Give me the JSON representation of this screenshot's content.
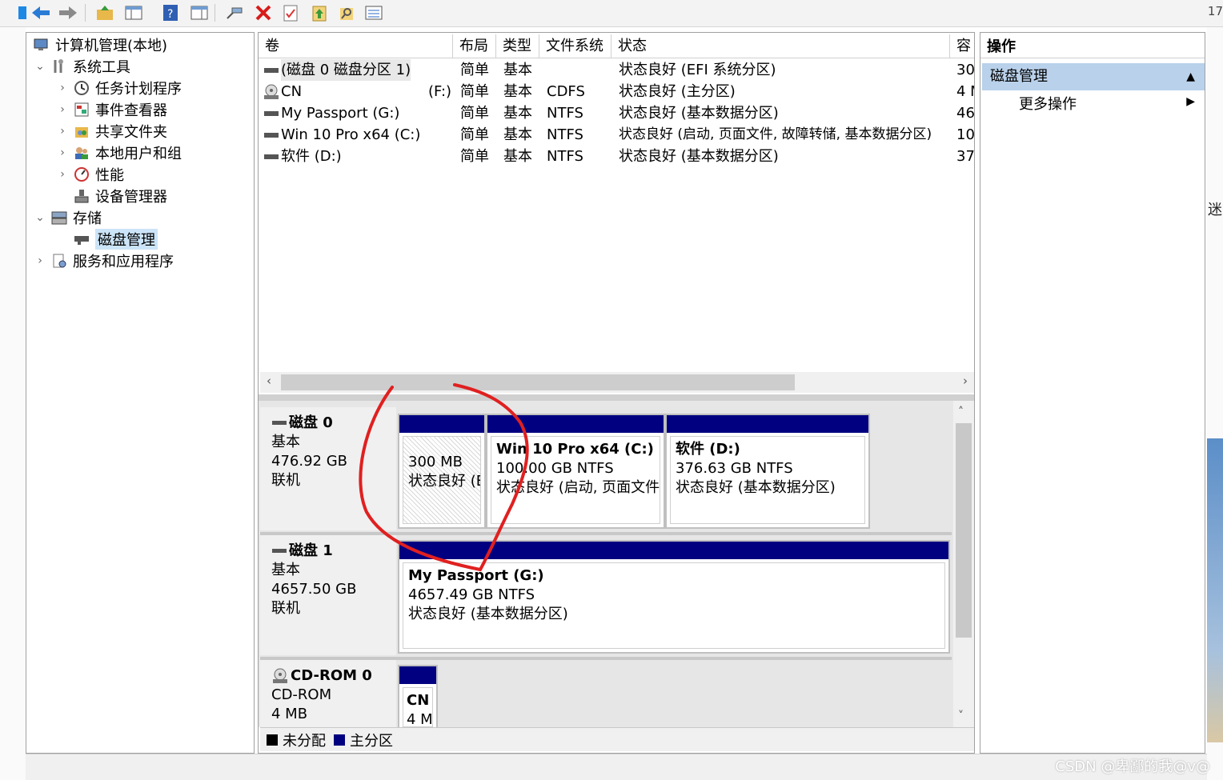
{
  "toolbar": {
    "right_text": "17"
  },
  "tree": [
    {
      "label": "计算机管理(本地)",
      "icon": "computer-management-icon",
      "level": 0,
      "chev": ""
    },
    {
      "label": "系统工具",
      "icon": "system-tools-icon",
      "level": 1,
      "chev": "⌄"
    },
    {
      "label": "任务计划程序",
      "icon": "task-scheduler-icon",
      "level": 2,
      "chev": "›"
    },
    {
      "label": "事件查看器",
      "icon": "event-viewer-icon",
      "level": 2,
      "chev": "›"
    },
    {
      "label": "共享文件夹",
      "icon": "shared-folders-icon",
      "level": 2,
      "chev": "›"
    },
    {
      "label": "本地用户和组",
      "icon": "local-users-icon",
      "level": 2,
      "chev": "›"
    },
    {
      "label": "性能",
      "icon": "performance-icon",
      "level": 2,
      "chev": "›"
    },
    {
      "label": "设备管理器",
      "icon": "device-manager-icon",
      "level": 2,
      "chev": ""
    },
    {
      "label": "存储",
      "icon": "storage-icon",
      "level": 1,
      "chev": "⌄"
    },
    {
      "label": "磁盘管理",
      "icon": "disk-management-icon",
      "level": 2,
      "chev": "",
      "selected": true
    },
    {
      "label": "服务和应用程序",
      "icon": "services-apps-icon",
      "level": 1,
      "chev": "›"
    }
  ],
  "volume_list": {
    "headers": [
      "卷",
      "布局",
      "类型",
      "文件系统",
      "状态",
      "容"
    ],
    "rows": [
      {
        "vol": "(磁盘 0 磁盘分区 1)",
        "drive": "",
        "layout": "简单",
        "type": "基本",
        "fs": "",
        "status": "状态良好 (EFI 系统分区)",
        "cap": "30",
        "icon": "drive-icon",
        "selected": true
      },
      {
        "vol": "CN",
        "drive": "(F:)",
        "layout": "简单",
        "type": "基本",
        "fs": "CDFS",
        "status": "状态良好 (主分区)",
        "cap": "4 M",
        "icon": "cdrom-icon"
      },
      {
        "vol": "My Passport (G:)",
        "drive": "",
        "layout": "简单",
        "type": "基本",
        "fs": "NTFS",
        "status": "状态良好 (基本数据分区)",
        "cap": "46",
        "icon": "drive-icon"
      },
      {
        "vol": "Win 10 Pro x64 (C:)",
        "drive": "",
        "layout": "简单",
        "type": "基本",
        "fs": "NTFS",
        "status": "状态良好 (启动, 页面文件, 故障转储, 基本数据分区)",
        "cap": "10",
        "icon": "drive-icon"
      },
      {
        "vol": "软件 (D:)",
        "drive": "",
        "layout": "简单",
        "type": "基本",
        "fs": "NTFS",
        "status": "状态良好 (基本数据分区)",
        "cap": "37",
        "icon": "drive-icon"
      }
    ]
  },
  "disks": [
    {
      "name": "磁盘 0",
      "type": "基本",
      "size": "476.92 GB",
      "state": "联机",
      "partitions": [
        {
          "title": "",
          "line1": "300 MB",
          "line2": "状态良好 (E"
        },
        {
          "title": "Win 10 Pro x64  (C:)",
          "line1": "100.00 GB NTFS",
          "line2": "状态良好 (启动, 页面文件"
        },
        {
          "title": "软件  (D:)",
          "line1": "376.63 GB NTFS",
          "line2": "状态良好 (基本数据分区)"
        }
      ]
    },
    {
      "name": "磁盘 1",
      "type": "基本",
      "size": "4657.50 GB",
      "state": "联机",
      "partitions": [
        {
          "title": "My Passport  (G:)",
          "line1": "4657.49 GB NTFS",
          "line2": "状态良好 (基本数据分区)"
        }
      ]
    },
    {
      "name": "CD-ROM 0",
      "type": "CD-ROM",
      "size": "4 MB",
      "state": "",
      "partitions": [
        {
          "title": "CN",
          "line1": "4 M",
          "line2": ""
        }
      ]
    }
  ],
  "legend": [
    {
      "label": "未分配",
      "color": "#000000"
    },
    {
      "label": "主分区",
      "color": "#000080"
    }
  ],
  "actions": {
    "header": "操作",
    "section": "磁盘管理",
    "item": "更多操作"
  },
  "watermark": "CSDN @卑鄙的我@v@",
  "edge_text": "迷",
  "colors": {
    "partition_bar": "#000080",
    "selection": "#cce4f7",
    "action_section": "#b9d1ea",
    "annotation": "#e02020"
  }
}
